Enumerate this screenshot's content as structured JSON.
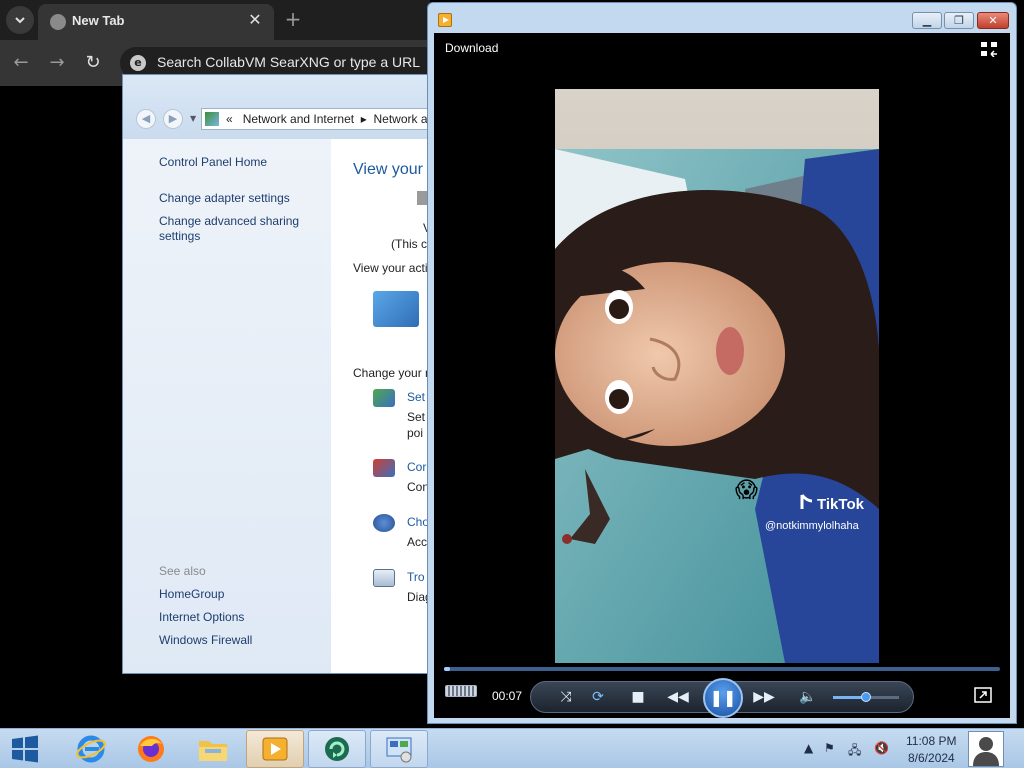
{
  "browser": {
    "tab_title": "New Tab",
    "close_glyph": "✕",
    "new_tab_glyph": "+",
    "omnibox_text": "Search CollabVM SearXNG or type a URL",
    "omnibox_icon": "e"
  },
  "control_panel": {
    "breadcrumb_prefix": "«",
    "breadcrumb_1": "Network and Internet",
    "breadcrumb_sep": "▸",
    "breadcrumb_2": "Network a",
    "left_links": [
      "Control Panel Home",
      "Change adapter settings",
      "Change advanced sharing settings"
    ],
    "see_also_label": "See also",
    "see_also_links": [
      "HomeGroup",
      "Internet Options",
      "Windows Firewall"
    ],
    "main_title": "View your",
    "main_fragments": {
      "v": "V",
      "this": "(This c",
      "view_active": "View your acti",
      "change_your": "Change your n",
      "set": "Set",
      "set_desc1": "Set",
      "set_desc2": "poi",
      "con": "Cor",
      "con_desc": "Con",
      "cho": "Cho",
      "cho_desc": "Acc",
      "tro": "Tro",
      "tro_desc": "Diag"
    }
  },
  "media_player": {
    "download_label": "Download",
    "time": "00:07",
    "progress_fraction": 0.01,
    "volume_fraction": 0.5,
    "video_overlay": {
      "brand": "TikTok",
      "handle": "@notkimmylolhaha",
      "emoji": "😱"
    }
  },
  "taskbar": {
    "clock_time": "11:08 PM",
    "clock_date": "8/6/2024"
  },
  "colors": {
    "taskbar": "#b7d0ea",
    "media_accent": "#1a4fa0",
    "cp_link": "#1e3e6e"
  }
}
